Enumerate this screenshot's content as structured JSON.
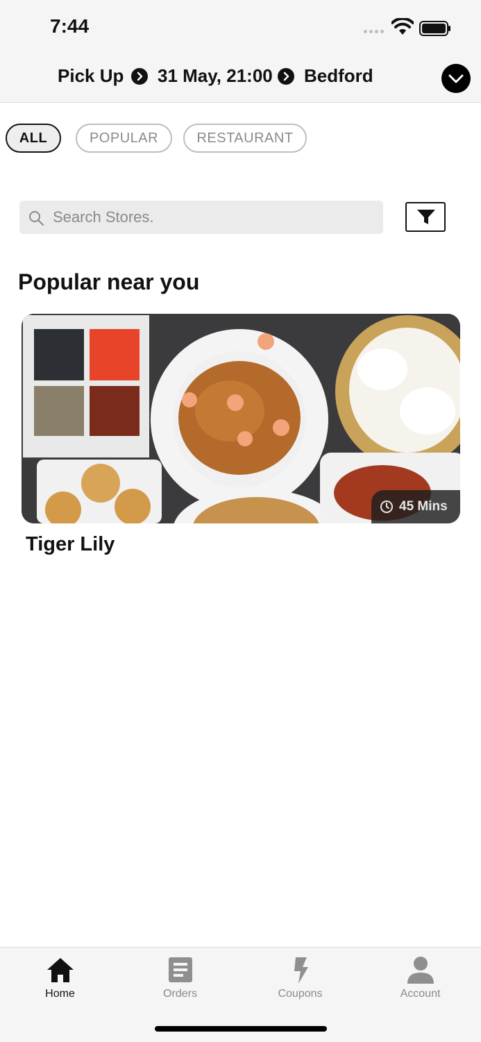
{
  "status_bar": {
    "time": "7:44"
  },
  "context": {
    "mode": "Pick Up",
    "datetime": "31 May, 21:00",
    "location": "Bedford"
  },
  "filters": {
    "chips": [
      {
        "label": "ALL",
        "active": true
      },
      {
        "label": "POPULAR",
        "active": false
      },
      {
        "label": "RESTAURANT",
        "active": false
      }
    ]
  },
  "search": {
    "placeholder": "Search Stores."
  },
  "section": {
    "title": "Popular near you"
  },
  "stores": [
    {
      "name": "Tiger Lily",
      "eta": "45 Mins",
      "image_icon": "food-photo"
    }
  ],
  "tabbar": {
    "tabs": [
      {
        "label": "Home",
        "icon": "home-icon",
        "active": true
      },
      {
        "label": "Orders",
        "icon": "orders-icon",
        "active": false
      },
      {
        "label": "Coupons",
        "icon": "coupons-icon",
        "active": false
      },
      {
        "label": "Account",
        "icon": "account-icon",
        "active": false
      }
    ]
  },
  "colors": {
    "accent": "#000000",
    "header_bg": "#f5f5f5",
    "muted_text": "#8a8a8a",
    "search_bg": "#ebebeb"
  }
}
